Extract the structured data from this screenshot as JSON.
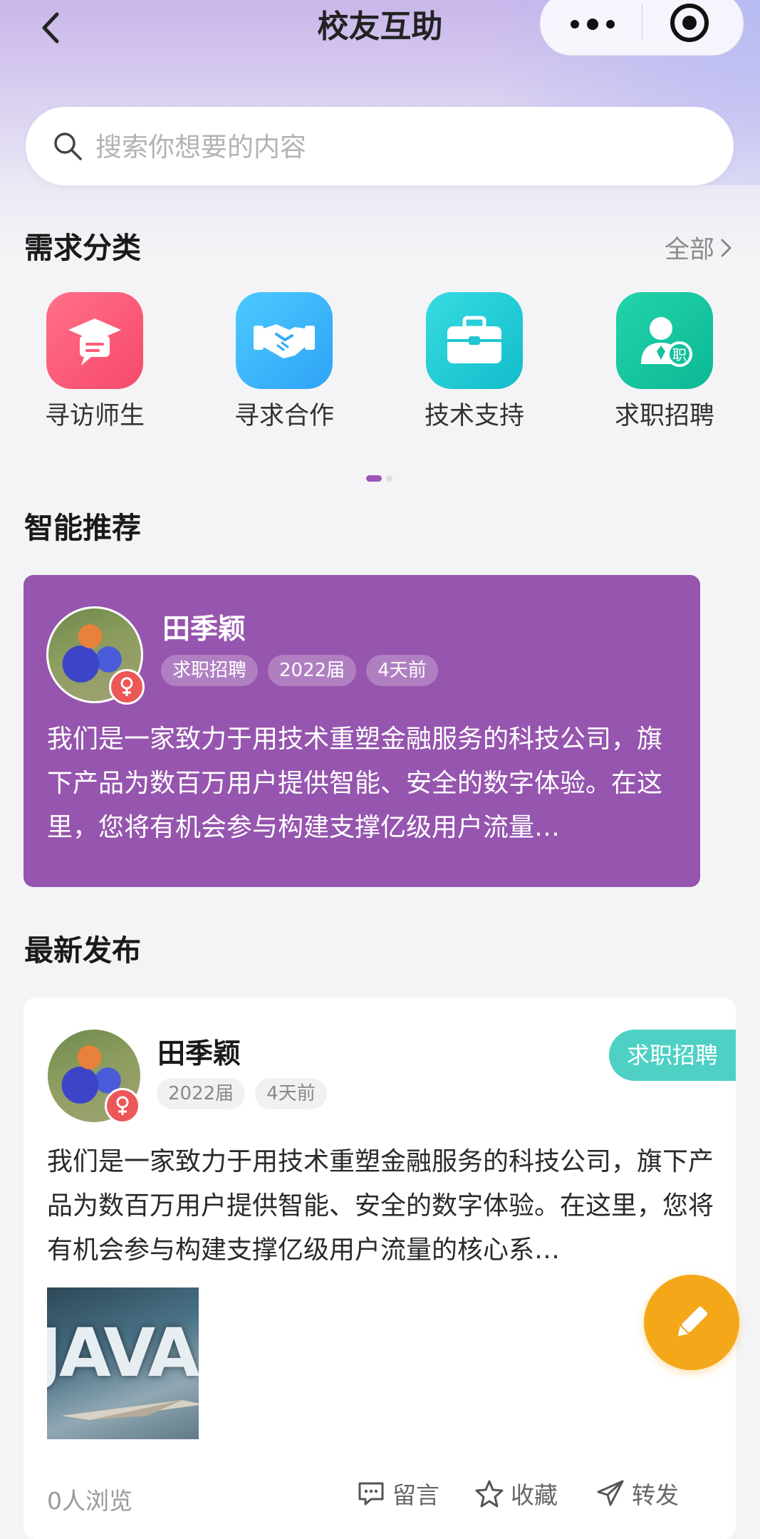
{
  "nav": {
    "title": "校友互助"
  },
  "search": {
    "placeholder": "搜索你想要的内容"
  },
  "categories": {
    "title": "需求分类",
    "all_label": "全部",
    "items": [
      {
        "label": "寻访师生",
        "icon": "graduation-chat-icon",
        "color": "#fb5d79"
      },
      {
        "label": "寻求合作",
        "icon": "handshake-icon",
        "color": "#38b4fb"
      },
      {
        "label": "技术支持",
        "icon": "toolbox-icon",
        "color": "#21cbd6"
      },
      {
        "label": "求职招聘",
        "icon": "job-person-icon",
        "color": "#14c9a0"
      }
    ]
  },
  "recommend": {
    "title": "智能推荐",
    "card": {
      "name": "田季颖",
      "tags": [
        "求职招聘",
        "2022届",
        "4天前"
      ],
      "text": "我们是一家致力于用技术重塑金融服务的科技公司，旗下产品为数百万用户提供智能、安全的数字体验。在这里，您将有机会参与构建支撑亿级用户流量…",
      "bg_color": "#9655ae"
    }
  },
  "latest": {
    "title": "最新发布",
    "post": {
      "name": "田季颖",
      "tags": [
        "2022届",
        "4天前"
      ],
      "badge": "求职招聘",
      "text": "我们是一家致力于用技术重塑金融服务的科技公司，旗下产品为数百万用户提供智能、安全的数字体验。在这里，您将有机会参与构建支撑亿级用户流量的核心系…",
      "image_text": "JAVA",
      "views": "0人浏览",
      "actions": {
        "comment": "留言",
        "favorite": "收藏",
        "share": "转发"
      }
    }
  },
  "fab": {
    "icon": "pencil-icon",
    "color": "#f5a71a"
  }
}
